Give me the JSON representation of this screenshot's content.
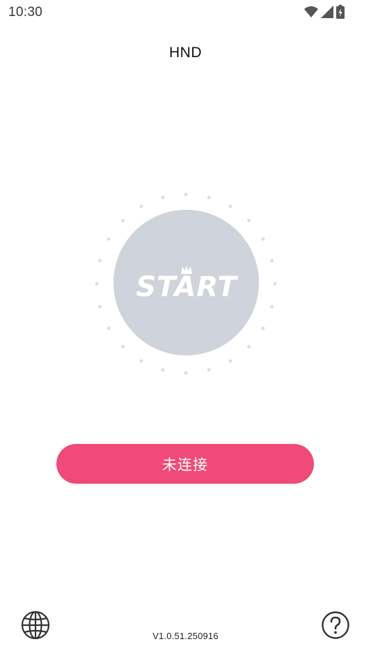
{
  "status_bar": {
    "time": "10:30",
    "icons": [
      "wifi-icon",
      "signal-icon",
      "battery-charging-icon"
    ]
  },
  "header": {
    "title": "HND"
  },
  "dial": {
    "logo_text": "START",
    "icon": "crown-icon",
    "circle_color": "#cfd3db",
    "dot_color": "#d9dce2"
  },
  "connect": {
    "label": "未连接",
    "color": "#ef4a78"
  },
  "footer": {
    "version": "V1.0.51.250916",
    "left_icon": "globe-icon",
    "right_icon": "help-icon"
  }
}
